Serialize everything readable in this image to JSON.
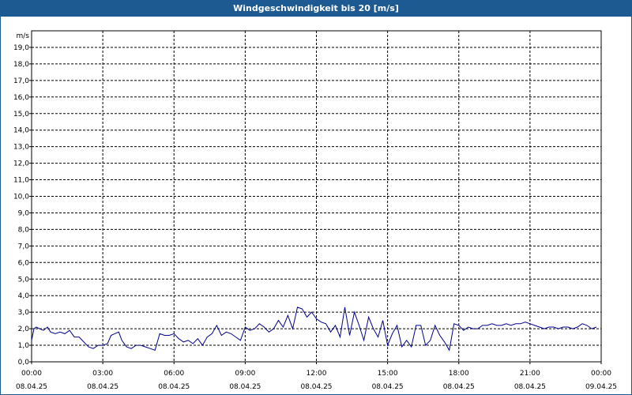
{
  "window": {
    "title": "Windgeschwindigkeit bis 20 [m/s]"
  },
  "chart_data": {
    "type": "line",
    "title": "Windgeschwindigkeit bis 20 [m/s]",
    "ylabel": "m/s",
    "xlabel": "",
    "ylim": [
      0,
      20
    ],
    "xlim_hours": [
      0,
      24
    ],
    "grid": true,
    "y_ticks": [
      "0,0",
      "1,0",
      "2,0",
      "3,0",
      "4,0",
      "5,0",
      "6,0",
      "7,0",
      "8,0",
      "9,0",
      "10,0",
      "11,0",
      "12,0",
      "13,0",
      "14,0",
      "15,0",
      "16,0",
      "17,0",
      "18,0",
      "19,0"
    ],
    "x_ticks": [
      {
        "time": "00:00",
        "date": "08.04.25"
      },
      {
        "time": "03:00",
        "date": "08.04.25"
      },
      {
        "time": "06:00",
        "date": "08.04.25"
      },
      {
        "time": "09:00",
        "date": "08.04.25"
      },
      {
        "time": "12:00",
        "date": "08.04.25"
      },
      {
        "time": "15:00",
        "date": "08.04.25"
      },
      {
        "time": "18:00",
        "date": "08.04.25"
      },
      {
        "time": "21:00",
        "date": "08.04.25"
      },
      {
        "time": "00:00",
        "date": "09.04.25"
      }
    ],
    "series": [
      {
        "color": "#00008b",
        "x_hours": [
          0.0,
          0.1,
          0.2,
          0.33,
          0.5,
          0.67,
          0.8,
          1.0,
          1.2,
          1.4,
          1.6,
          1.8,
          2.0,
          2.2,
          2.4,
          2.6,
          2.8,
          3.0,
          3.2,
          3.35,
          3.5,
          3.67,
          3.8,
          4.0,
          4.2,
          4.4,
          4.6,
          4.8,
          5.0,
          5.2,
          5.4,
          5.6,
          5.8,
          6.0,
          6.2,
          6.4,
          6.6,
          6.8,
          7.0,
          7.2,
          7.4,
          7.6,
          7.8,
          8.0,
          8.2,
          8.4,
          8.6,
          8.8,
          9.0,
          9.2,
          9.4,
          9.6,
          9.8,
          10.0,
          10.2,
          10.4,
          10.6,
          10.8,
          11.0,
          11.2,
          11.4,
          11.6,
          11.8,
          12.0,
          12.2,
          12.4,
          12.6,
          12.8,
          13.0,
          13.2,
          13.4,
          13.6,
          13.8,
          14.0,
          14.2,
          14.4,
          14.6,
          14.8,
          15.0,
          15.2,
          15.4,
          15.6,
          15.8,
          16.0,
          16.2,
          16.4,
          16.6,
          16.8,
          17.0,
          17.2,
          17.4,
          17.6,
          17.8,
          18.0,
          18.2,
          18.4,
          18.6,
          18.8,
          19.0,
          19.2,
          19.4,
          19.6,
          19.8,
          20.0,
          20.2,
          20.4,
          20.6,
          20.8,
          21.0,
          21.2,
          21.4,
          21.6,
          21.8,
          22.0,
          22.2,
          22.4,
          22.6,
          22.8,
          23.0,
          23.2,
          23.4,
          23.6,
          23.8
        ],
        "values": [
          1.3,
          2.0,
          2.1,
          2.0,
          1.9,
          2.1,
          1.8,
          1.7,
          1.8,
          1.7,
          1.9,
          1.5,
          1.5,
          1.2,
          0.9,
          0.8,
          1.0,
          1.0,
          1.1,
          1.6,
          1.7,
          1.8,
          1.3,
          0.9,
          0.8,
          1.0,
          1.0,
          0.9,
          0.8,
          0.7,
          1.7,
          1.6,
          1.6,
          1.7,
          1.4,
          1.2,
          1.3,
          1.1,
          1.4,
          1.0,
          1.5,
          1.7,
          2.2,
          1.6,
          1.8,
          1.7,
          1.5,
          1.3,
          2.1,
          1.9,
          2.0,
          2.3,
          2.1,
          1.8,
          2.0,
          2.5,
          2.1,
          2.8,
          2.0,
          3.3,
          3.2,
          2.7,
          3.0,
          2.6,
          2.4,
          2.3,
          1.8,
          2.2,
          1.5,
          3.3,
          1.6,
          3.0,
          2.2,
          1.3,
          2.7,
          2.0,
          1.5,
          2.5,
          1.0,
          1.7,
          2.2,
          0.9,
          1.3,
          0.9,
          2.2,
          2.2,
          1.0,
          1.3,
          2.2,
          1.6,
          1.2,
          0.7,
          2.3,
          2.2,
          1.9,
          2.1,
          2.0,
          2.0,
          2.2,
          2.2,
          2.3,
          2.2,
          2.2,
          2.3,
          2.2,
          2.3,
          2.3,
          2.4,
          2.3,
          2.2,
          2.1,
          2.0,
          2.1,
          2.1,
          2.0,
          2.1,
          2.1,
          2.0,
          2.1,
          2.3,
          2.2,
          2.0,
          2.1,
          2.2,
          2.2
        ]
      }
    ]
  }
}
